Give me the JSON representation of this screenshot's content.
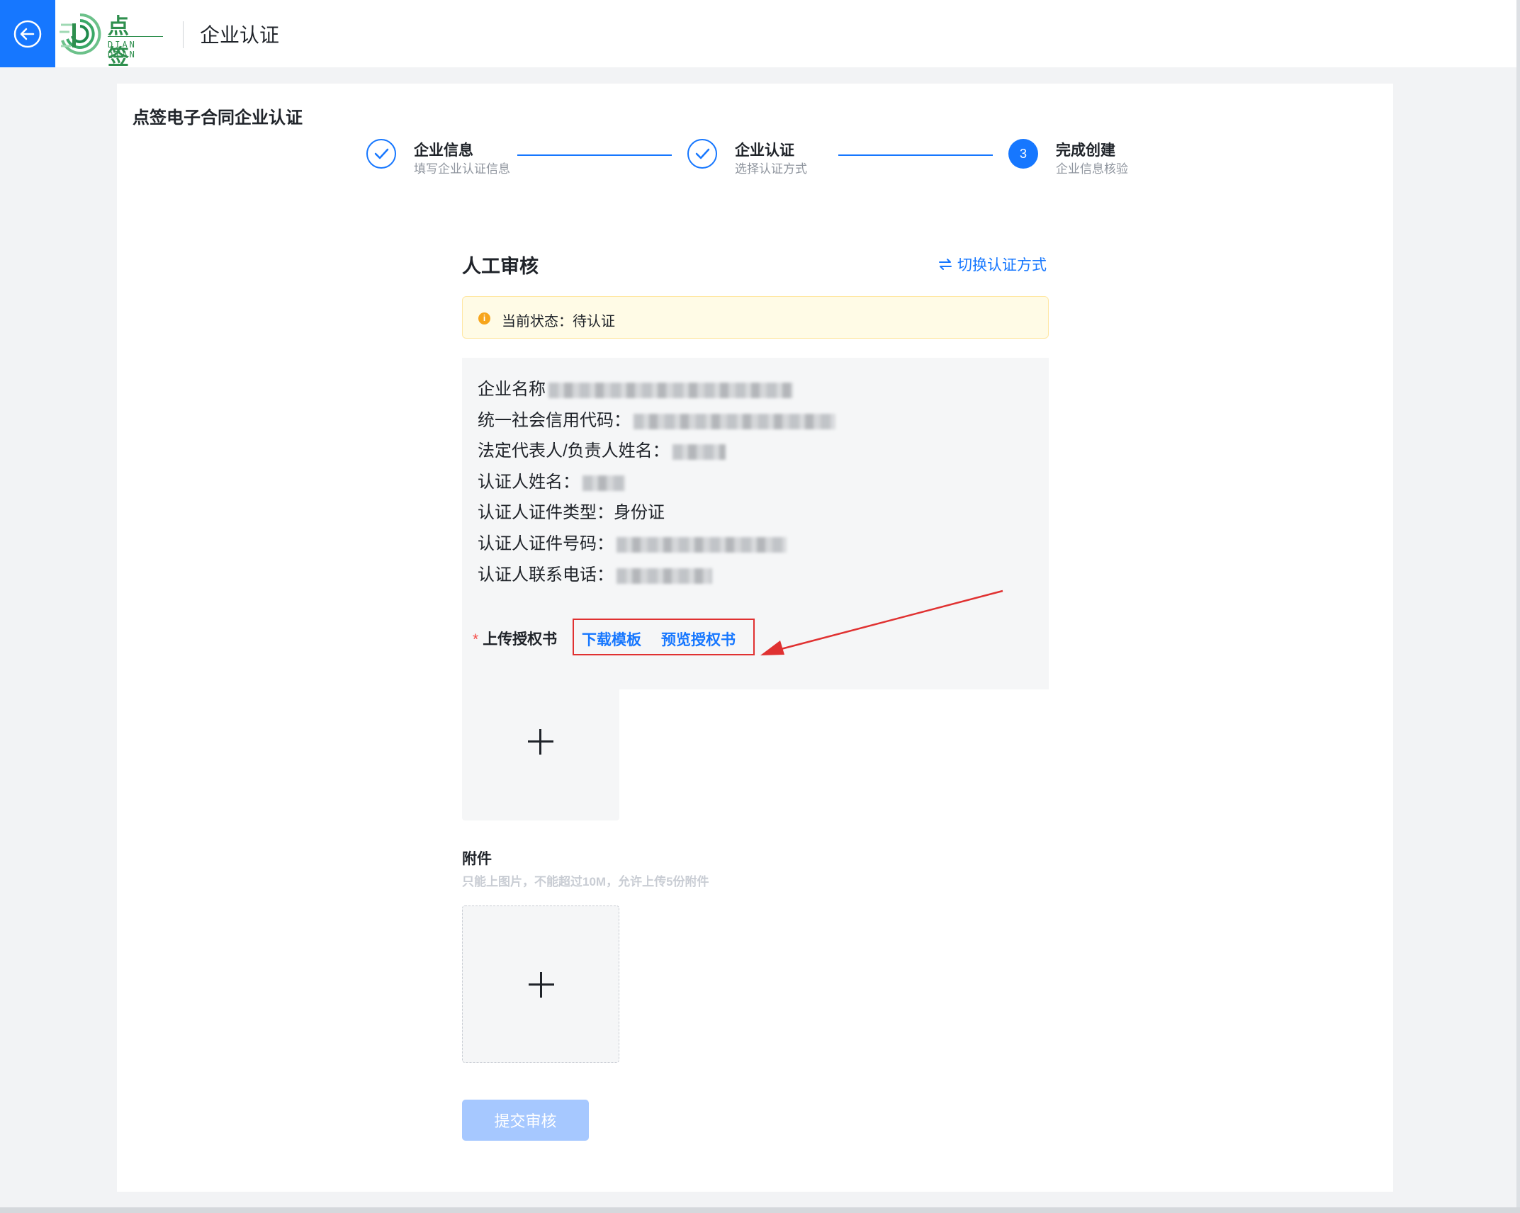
{
  "header": {
    "logo_cn": "点签",
    "logo_en": "DIAN QIAN",
    "title": "企业认证"
  },
  "card": {
    "title": "点签电子合同企业认证"
  },
  "steps": [
    {
      "title": "企业信息",
      "subtitle": "填写企业认证信息",
      "status": "done"
    },
    {
      "title": "企业认证",
      "subtitle": "选择认证方式",
      "status": "done"
    },
    {
      "number": "3",
      "title": "完成创建",
      "subtitle": "企业信息核验",
      "status": "active"
    }
  ],
  "review": {
    "title": "人工审核",
    "switch_label": "切换认证方式",
    "status_icon": "i",
    "status_text": "当前状态：待认证"
  },
  "info": [
    {
      "label": "企业名称"
    },
    {
      "label": "统一社会信用代码："
    },
    {
      "label": "法定代表人/负责人姓名："
    },
    {
      "label": "认证人姓名："
    },
    {
      "label": "认证人证件类型：",
      "value": "身份证"
    },
    {
      "label": "认证人证件号码："
    },
    {
      "label": "认证人联系电话："
    }
  ],
  "upload": {
    "required_mark": "*",
    "label": "上传授权书",
    "download_template": "下载模板",
    "preview": "预览授权书"
  },
  "attachment": {
    "title": "附件",
    "hint": "只能上图片，不能超过10M，允许上传5份附件"
  },
  "submit_label": "提交审核",
  "colors": {
    "primary": "#1677ff",
    "warning_bg": "#fffbe6",
    "warning_icon": "#f7a51c",
    "annotation_red": "#e03131",
    "submit_disabled": "#a6c8ff"
  }
}
